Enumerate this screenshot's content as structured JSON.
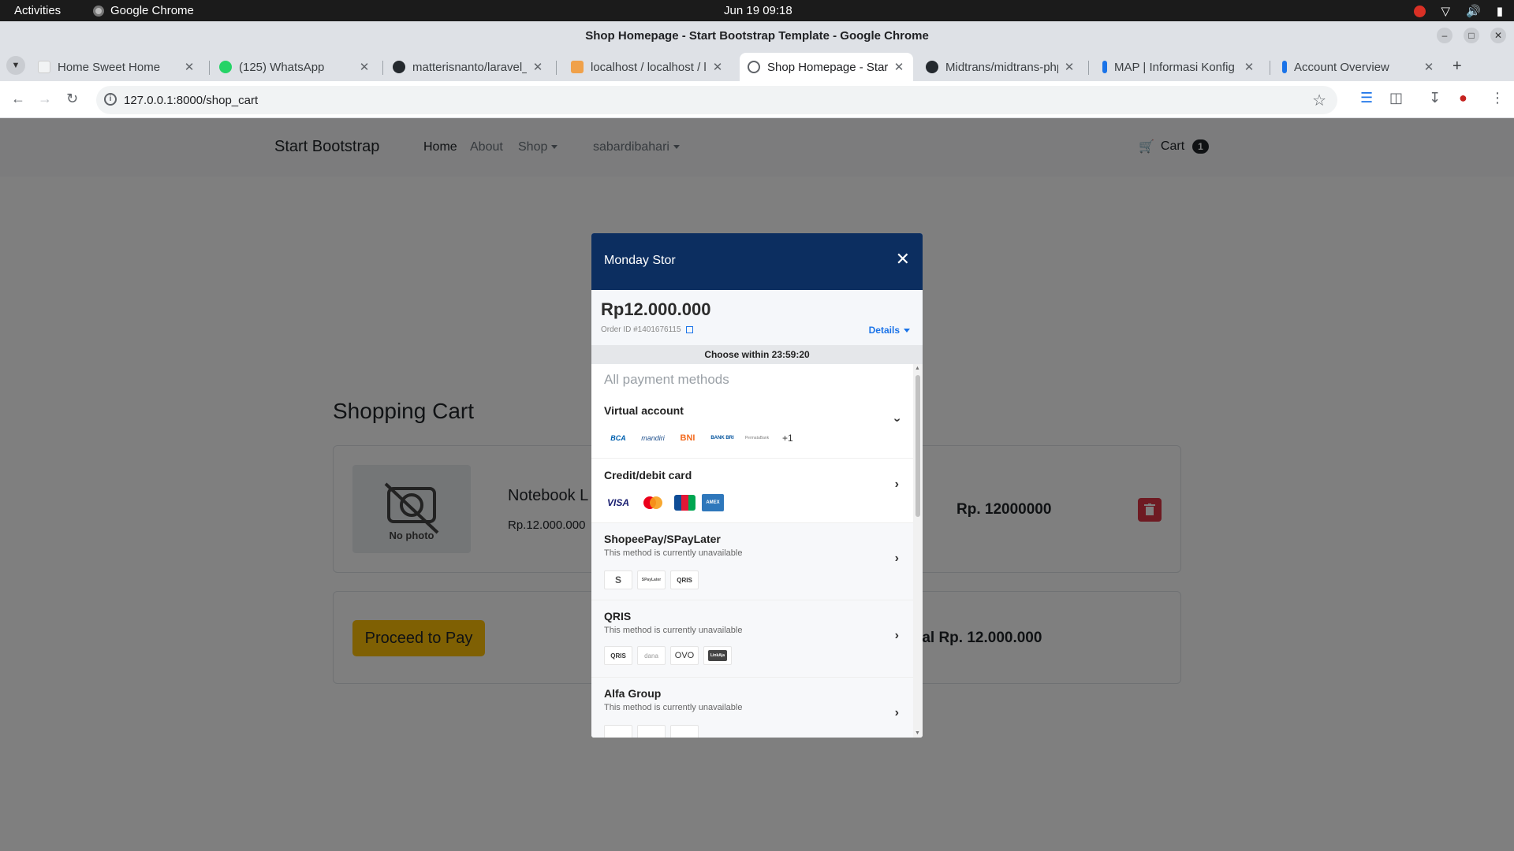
{
  "os": {
    "activities": "Activities",
    "app_name": "Google Chrome",
    "clock": "Jun 19  09:18"
  },
  "window": {
    "title": "Shop Homepage - Start Bootstrap Template - Google Chrome"
  },
  "tabs": [
    {
      "label": "Home Sweet Home",
      "active": false
    },
    {
      "label": "(125) WhatsApp",
      "active": false
    },
    {
      "label": "matterisnanto/laravel_",
      "active": false
    },
    {
      "label": "localhost / localhost / l",
      "active": false
    },
    {
      "label": "Shop Homepage - Start",
      "active": true
    },
    {
      "label": "Midtrans/midtrans-php",
      "active": false
    },
    {
      "label": "MAP | Informasi Konfig",
      "active": false
    },
    {
      "label": "Account Overview",
      "active": false
    }
  ],
  "address_bar": {
    "url": "127.0.0.1:8000/shop_cart"
  },
  "site": {
    "brand": "Start Bootstrap",
    "nav": {
      "home": "Home",
      "about": "About",
      "shop": "Shop",
      "user": "sabardibahari"
    },
    "cart_label": "Cart",
    "cart_count": "1"
  },
  "cart": {
    "title": "Shopping Cart",
    "item": {
      "no_photo": "No photo",
      "name": "Notebook L",
      "price": "Rp.12.000.000",
      "line_total": "Rp. 12000000"
    },
    "pay_button": "Proceed to Pay",
    "grand_total": "tal Rp. 12.000.000"
  },
  "payment_modal": {
    "merchant": "Monday Stor",
    "amount": "Rp12.000.000",
    "order_id": "Order ID #1401676115",
    "details": "Details",
    "timer": "Choose within  23:59:20",
    "all_methods": "All payment methods",
    "methods": [
      {
        "name": "Virtual account",
        "note": "",
        "logos": [
          "BCA",
          "mandiri",
          "BNI",
          "BANK BRI",
          "PermataBank"
        ],
        "more": "+1"
      },
      {
        "name": "Credit/debit card",
        "note": "",
        "logos": [
          "VISA",
          "mastercard",
          "JCB",
          "AMEX"
        ]
      },
      {
        "name": "ShopeePay/SPayLater",
        "note": "This method is currently unavailable",
        "logos": [
          "S",
          "SPayLater",
          "QRIS"
        ]
      },
      {
        "name": "QRIS",
        "note": "This method is currently unavailable",
        "logos": [
          "QRIS",
          "dana",
          "OVO",
          "LinkAja"
        ]
      },
      {
        "name": "Alfa Group",
        "note": "This method is currently unavailable",
        "logos": []
      }
    ]
  },
  "colors": {
    "modal_header": "#0c2e60",
    "link_blue": "#1a73e8",
    "pay_button": "#ffc107",
    "delete_button": "#dc3545"
  }
}
